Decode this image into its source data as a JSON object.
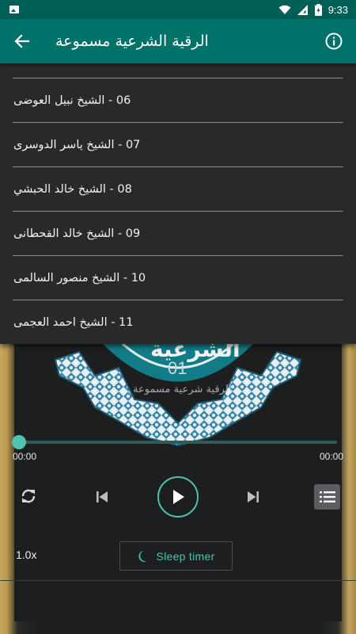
{
  "status_bar": {
    "time": "9:33"
  },
  "app_bar": {
    "title": "الرقية الشرعية مسموعة"
  },
  "list": {
    "items": [
      {
        "label": "06 - الشيخ نبيل العوضى"
      },
      {
        "label": "07 - الشيخ ياسر الدوسرى"
      },
      {
        "label": "08 - الشيخ خالد الحبشي"
      },
      {
        "label": "09 - الشيخ خالد القحطانى"
      },
      {
        "label": "10 - الشيخ منصور السالمى"
      },
      {
        "label": "11 - الشيخ احمد العجمى"
      }
    ]
  },
  "artwork": {
    "number": "01",
    "caption": "الرقية شرعية مسموعة"
  },
  "player": {
    "current_time": "00:00",
    "total_time": "00:00",
    "progress": 0,
    "speed": "1.0x",
    "sleep_timer_label": "Sleep timer"
  },
  "colors": {
    "app_bar": "#007269",
    "status_bar": "#005f57",
    "accent": "#4ec3ae",
    "list_bg": "#27292b",
    "divider": "#8c8e90"
  },
  "icons": {
    "back": "arrow-left-icon",
    "info": "info-circle-icon",
    "repeat": "repeat-icon",
    "previous": "skip-previous-icon",
    "play": "play-icon",
    "next": "skip-next-icon",
    "playlist": "playlist-icon",
    "sleep": "moon-icon"
  }
}
